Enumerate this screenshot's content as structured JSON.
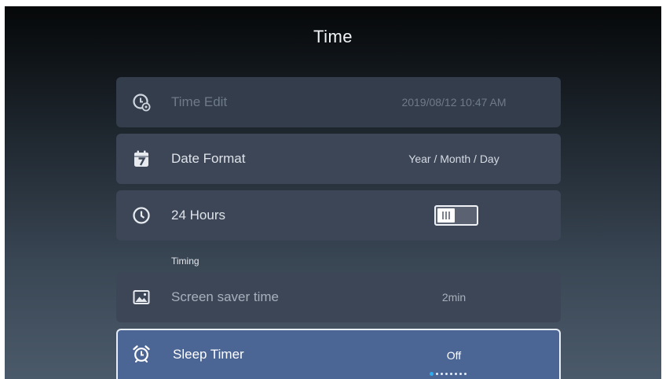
{
  "header": {
    "title": "Time"
  },
  "settings": {
    "time_edit": {
      "icon": "clock-gear-icon",
      "label": "Time Edit",
      "value": "2019/08/12 10:47 AM"
    },
    "date_format": {
      "icon": "calendar-icon",
      "label": "Date Format",
      "value": "Year / Month / Day"
    },
    "hours_24": {
      "icon": "clock-icon",
      "label": "24 Hours",
      "toggle_on": false
    }
  },
  "timing": {
    "section_label": "Timing",
    "screen_saver": {
      "icon": "image-icon",
      "label": "Screen saver time",
      "value": "2min"
    },
    "sleep_timer": {
      "icon": "alarm-clock-icon",
      "label": "Sleep Timer",
      "value": "Off",
      "option_count": 8,
      "selected_option_index": 0
    }
  },
  "colors": {
    "selected_row": "#4b6595",
    "row": "#3c4657",
    "indicator_active": "#2ab0f2"
  }
}
